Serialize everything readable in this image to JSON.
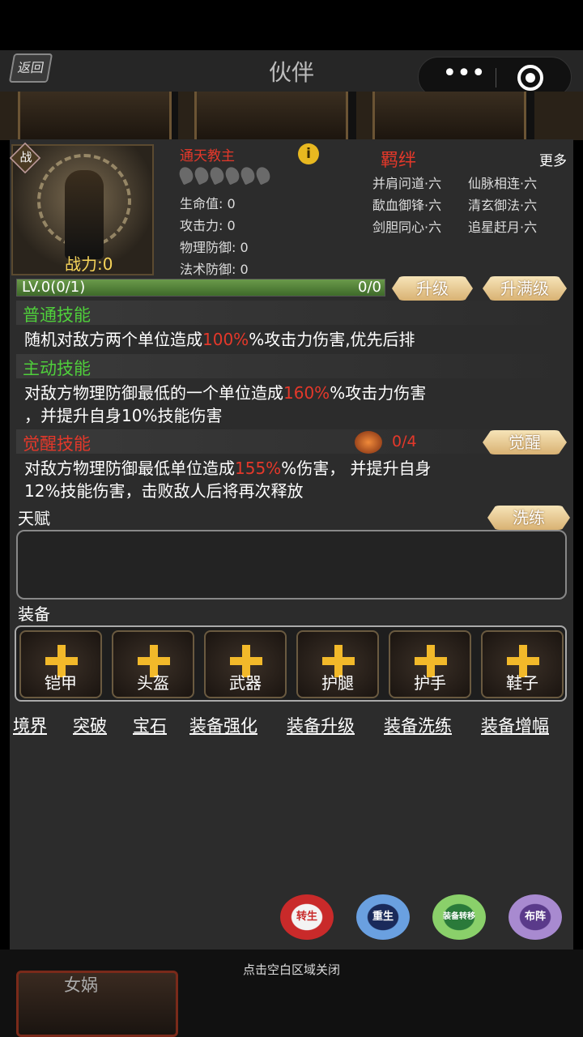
{
  "nav": {
    "back_label": "返回",
    "title": "伙伴",
    "more_icon": "•••"
  },
  "hero": {
    "war_badge": "战",
    "power": "战力:0",
    "name": "通天教主",
    "stats": [
      "生命值: 0",
      "攻击力: 0",
      "物理防御: 0",
      "法术防御: 0"
    ]
  },
  "bonds": {
    "title": "羁绊",
    "more": "更多",
    "rows": [
      [
        "并肩问道·六",
        "仙脉相连·六"
      ],
      [
        "歃血御锋·六",
        "清玄御法·六"
      ],
      [
        "剑胆同心·六",
        "追星赶月·六"
      ]
    ]
  },
  "level": {
    "text": "LV.0(0/1)",
    "count": "0/0",
    "progress": 1.0,
    "upgrade": "升级",
    "upgrade_max": "升满级"
  },
  "skills": {
    "normal": {
      "title": "普通技能",
      "pre": "随机对敌方两个单位造成",
      "hl": "100%",
      "post": "%攻击力伤害,优先后排"
    },
    "active": {
      "title": "主动技能",
      "pre": "对敌方物理防御最低的一个单位造成",
      "hl": "160%",
      "post": "%攻击力伤害",
      "line2": "，并提升自身10%技能伤害"
    },
    "awake": {
      "title": "觉醒技能",
      "count": "0/4",
      "button": "觉醒",
      "pre": "对敌方物理防御最低单位造成",
      "hl": "155%",
      "post": "%伤害， 并提升自身",
      "line2": "12%技能伤害，击败敌人后将再次释放"
    }
  },
  "talent": {
    "label": "天赋",
    "button": "洗练"
  },
  "equipment": {
    "label": "装备",
    "slots": [
      "铠甲",
      "头盔",
      "武器",
      "护腿",
      "护手",
      "鞋子"
    ]
  },
  "links": [
    "境界",
    "突破",
    "宝石",
    "装备强化",
    "装备升级",
    "装备洗练",
    "装备增幅"
  ],
  "round_buttons": [
    "转生",
    "重生",
    "装备转移",
    "布阵"
  ],
  "bottom": {
    "close_hint": "点击空白区域关闭",
    "partner_name": "女娲"
  },
  "colors": {
    "accent_red": "#e4382a",
    "accent_green": "#4fcf3b",
    "gold": "#f2b92a"
  }
}
